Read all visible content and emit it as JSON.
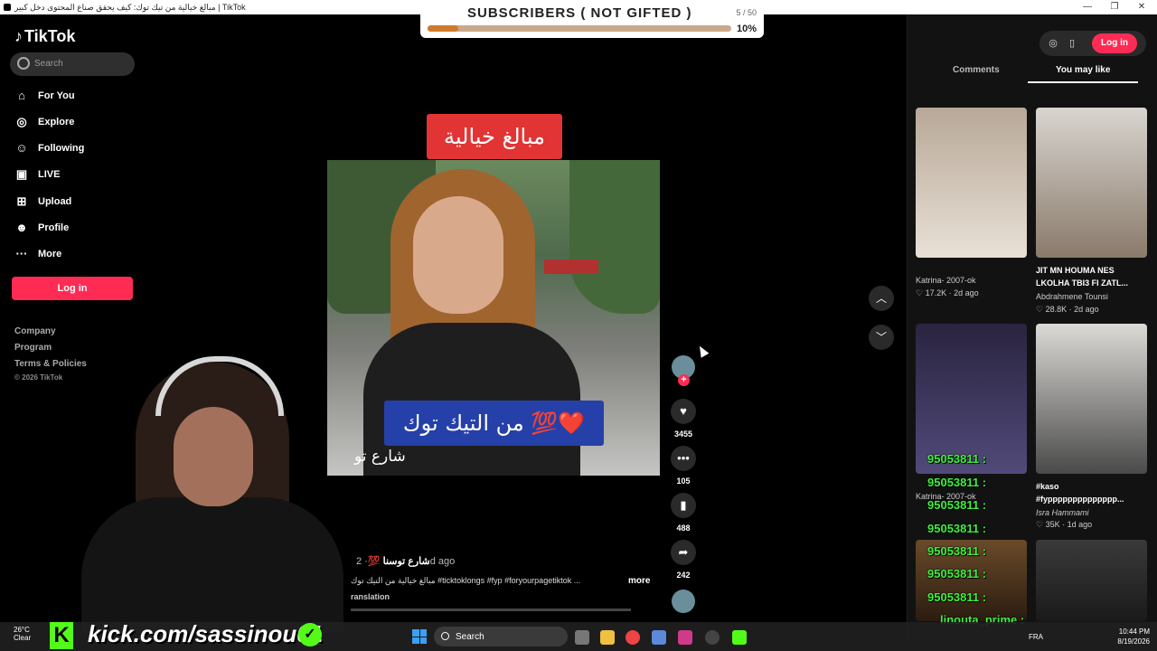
{
  "window": {
    "title": "مبالغ خيالية من تيك توك: كيف يحقق صناع المحتوى دخل كبير | TikTok"
  },
  "subscribers": {
    "label": "SUBSCRIBERS ( NOT GIFTED )",
    "count": "5 / 50",
    "percent_text": "10%",
    "progress": 0.1
  },
  "sidebar": {
    "logo": "TikTok",
    "search_placeholder": "Search",
    "nav": [
      {
        "label": "For You",
        "icon": "home-icon"
      },
      {
        "label": "Explore",
        "icon": "compass-icon"
      },
      {
        "label": "Following",
        "icon": "following-icon"
      },
      {
        "label": "LIVE",
        "icon": "live-icon"
      },
      {
        "label": "Upload",
        "icon": "upload-icon"
      },
      {
        "label": "Profile",
        "icon": "profile-icon"
      },
      {
        "label": "More",
        "icon": "more-icon"
      }
    ],
    "login": "Log in",
    "footer": [
      "Company",
      "Program",
      "Terms & Policies"
    ],
    "copyright": "© 2026 TikTok"
  },
  "video": {
    "top_caption": "مبالغ خيالية",
    "mid_caption": "من التيك توك 💯❤️",
    "bottom_text": "شارع تو",
    "author": "شارع توسنا 💯",
    "date": "· 2d ago",
    "description": "مبالغ خيالية من التيك توك #ticktoklongs #fyp #foryourpagetiktok ...",
    "more": "more",
    "translation": "ranslation",
    "actions": {
      "likes": "3455",
      "comments": "105",
      "saves": "488",
      "shares": "242"
    }
  },
  "right_panel": {
    "login": "Log in",
    "tabs": [
      "Comments",
      "You may like"
    ],
    "active_tab": "You may like",
    "cards": [
      {
        "title": "",
        "author": "Katrina- 2007-ok",
        "meta": "♡ 17.2K · 2d ago"
      },
      {
        "title": "JIT MN HOUMA NES LKOLHA TBI3 FI ZATL...",
        "author": "Abdrahmene Tounsi",
        "meta": "♡ 28.8K · 2d ago"
      },
      {
        "title": "",
        "author": "Katrina- 2007-ok",
        "meta": ""
      },
      {
        "title": "#kaso #fypppppppppppppp...",
        "author": "Isra Hammami",
        "meta": "♡ 35K · 1d ago"
      }
    ]
  },
  "chat": [
    "95053811 :",
    "95053811 :",
    "95053811 :",
    "95053811 :",
    "95053811 :",
    "95053811 :",
    "95053811 :",
    "linouta_prime :"
  ],
  "stream": {
    "kick_handle": "kick.com/sassinou01"
  },
  "taskbar": {
    "weather_temp": "26°C",
    "weather_text": "Clear",
    "search": "Search",
    "lang": "FRA",
    "time": "10:44 PM",
    "date": "8/19/2026"
  }
}
